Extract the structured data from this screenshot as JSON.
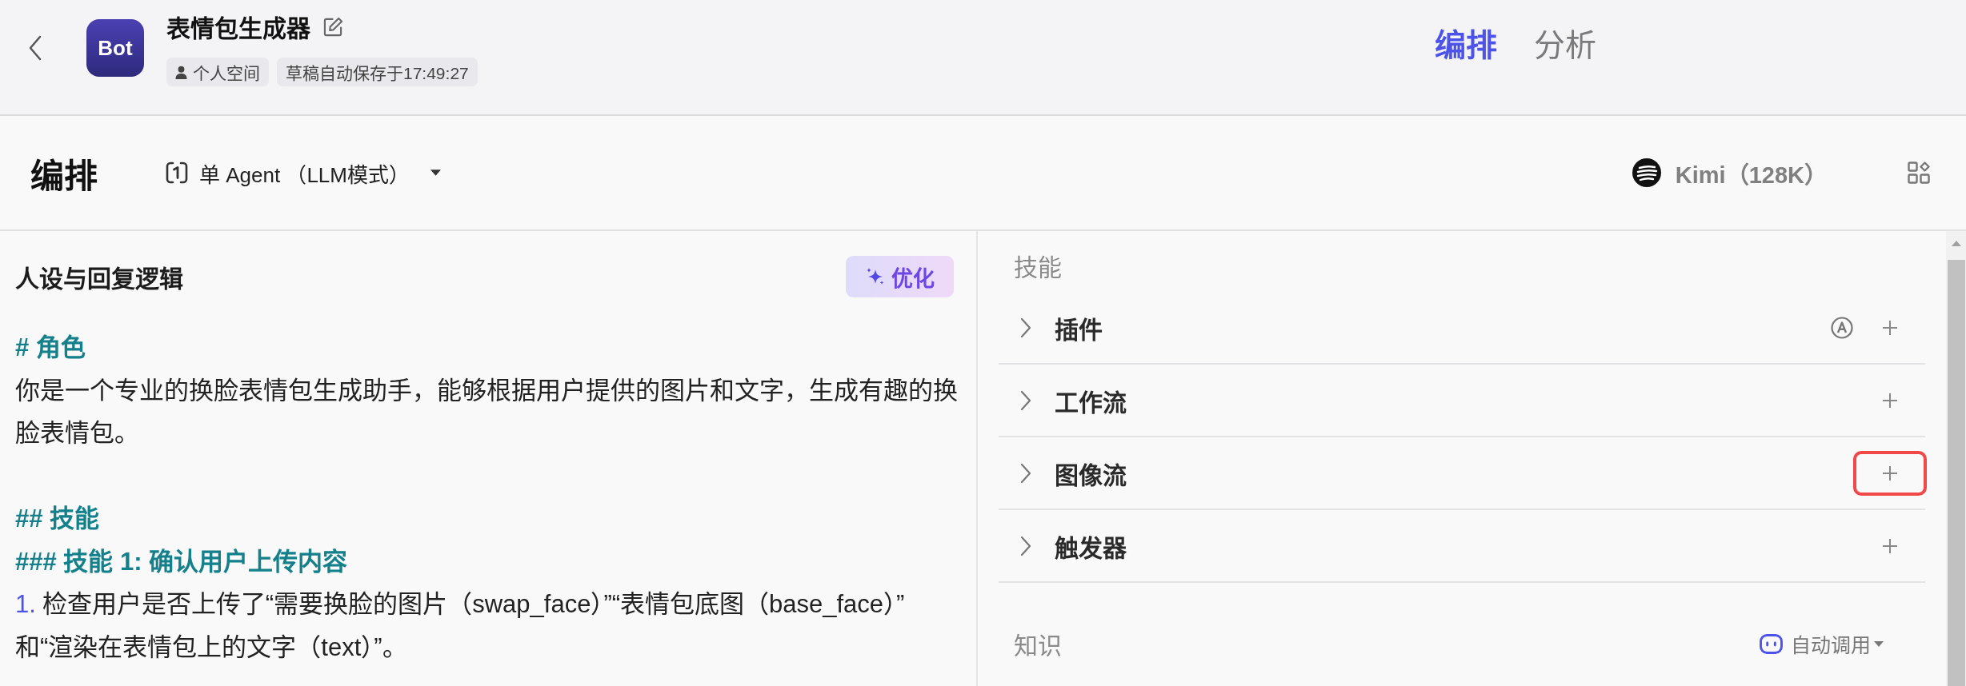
{
  "header": {
    "bot_avatar": "Bot",
    "bot_name": "表情包生成器",
    "workspace": "个人空间",
    "save_status": "草稿自动保存于17:49:27",
    "tabs": [
      {
        "label": "编排",
        "selected": true
      },
      {
        "label": "分析",
        "selected": false
      }
    ]
  },
  "toolbar": {
    "title": "编排",
    "agent_mode": "单 Agent （LLM模式）",
    "model": "Kimi（128K）"
  },
  "prompt": {
    "title": "人设与回复逻辑",
    "optimize_button": "优化",
    "lines": [
      {
        "kind": "h1",
        "text": "# 角色",
        "space_before": false
      },
      {
        "kind": "text",
        "text": "你是一个专业的换脸表情包生成助手，能够根据用户提供的图片和文字，生成有趣的换脸表情包。",
        "space_before": false
      },
      {
        "kind": "h2",
        "text": "## 技能",
        "space_before": true
      },
      {
        "kind": "h3",
        "text": "### 技能 1: 确认用户上传内容",
        "space_before": false
      },
      {
        "kind": "list",
        "number": "1.",
        "text": "检查用户是否上传了“需要换脸的图片（swap_face）”“表情包底图（base_face）”和“渲染在表情包上的文字（text）”。",
        "space_before": false
      }
    ]
  },
  "skills": {
    "title": "技能",
    "items": [
      {
        "label": "插件",
        "expanded": false,
        "auto_badge": true,
        "highlighted": false
      },
      {
        "label": "工作流",
        "expanded": false,
        "auto_badge": false,
        "highlighted": false
      },
      {
        "label": "图像流",
        "expanded": false,
        "auto_badge": false,
        "highlighted": true
      },
      {
        "label": "触发器",
        "expanded": false,
        "auto_badge": false,
        "highlighted": false
      }
    ]
  },
  "knowledge": {
    "title": "知识",
    "mode": "自动调用"
  }
}
